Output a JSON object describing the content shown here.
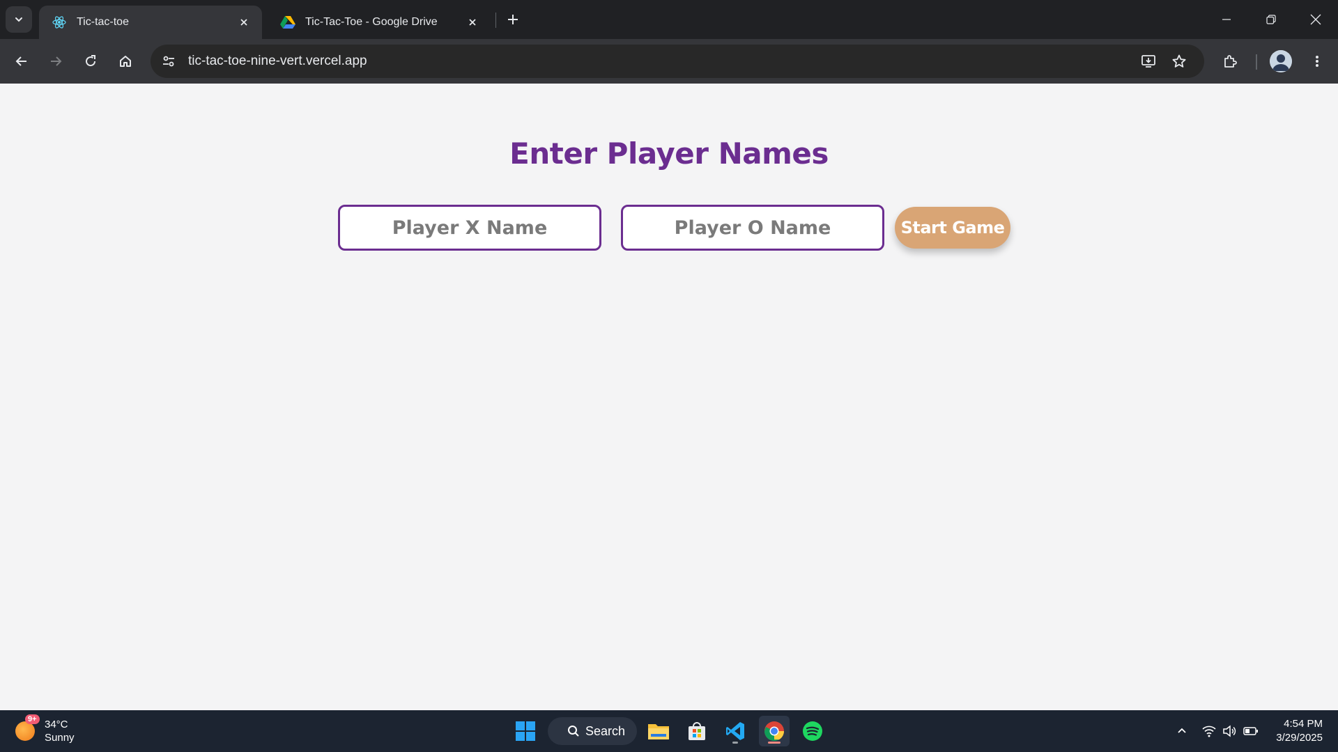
{
  "browser": {
    "tabs": [
      {
        "title": "Tic-tac-toe",
        "active": true,
        "favicon": "react-icon"
      },
      {
        "title": "Tic-Tac-Toe - Google Drive",
        "active": false,
        "favicon": "google-drive-icon"
      }
    ],
    "url": "tic-tac-toe-nine-vert.vercel.app"
  },
  "page": {
    "heading": "Enter Player Names",
    "player_x_placeholder": "Player X Name",
    "player_o_placeholder": "Player O Name",
    "player_x_value": "",
    "player_o_value": "",
    "start_button_label": "Start Game",
    "colors": {
      "heading": "#6b2d90",
      "input_border": "#6b2d90",
      "button": "#d9a575",
      "background": "#f4f4f5"
    }
  },
  "taskbar": {
    "weather": {
      "temperature": "34°C",
      "condition": "Sunny",
      "badge": "9+"
    },
    "search_label": "Search",
    "pinned": [
      "windows-start-icon",
      "search-icon",
      "file-explorer-icon",
      "microsoft-store-icon",
      "vscode-icon",
      "chrome-icon",
      "spotify-icon"
    ],
    "clock": {
      "time": "4:54 PM",
      "date": "3/29/2025"
    }
  }
}
